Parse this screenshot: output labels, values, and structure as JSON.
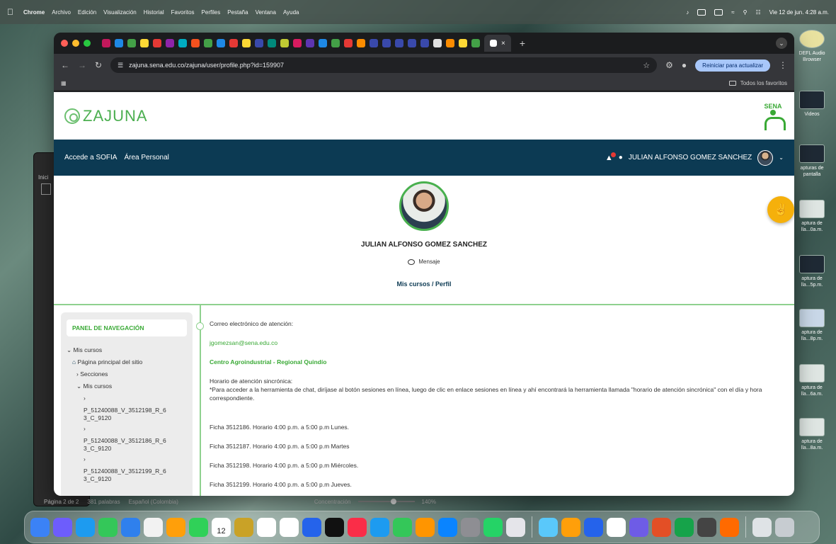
{
  "menubar": {
    "app": "Chrome",
    "items": [
      "Archivo",
      "Edición",
      "Visualización",
      "Historial",
      "Favoritos",
      "Perfiles",
      "Pestaña",
      "Ventana",
      "Ayuda"
    ],
    "datetime": "Vie 12 de jun. 4:28 a.m."
  },
  "desktop": {
    "items": [
      {
        "label": "DEFL Audio Browser"
      },
      {
        "label": "Videos"
      },
      {
        "label": "apturas de pantalla"
      },
      {
        "label": "aptura de lla...0a.m."
      },
      {
        "label": "aptura de lla...5p.m."
      },
      {
        "label": "aptura de lla...8p.m."
      },
      {
        "label": "aptura de lla...6a.m."
      },
      {
        "label": "aptura de lla...8a.m."
      }
    ]
  },
  "bg_window": {
    "label": "Inici"
  },
  "pages_status": {
    "page": "Página 2 de 2",
    "words": "381 palabras",
    "language": "Español (Colombia)",
    "focus": "Concentración",
    "zoom": "140%"
  },
  "chrome": {
    "address": "zajuna.sena.edu.co/zajuna/user/profile.php?id=159907",
    "update_button": "Reiniciar para actualizar",
    "bookmarks_folder": "Todos los favoritos",
    "colors": {
      "frame": "#202124",
      "toolbar": "#35363a",
      "update": "#a8c7fa"
    }
  },
  "site": {
    "logo_text": "ZAJUNA",
    "sena_text": "SENA",
    "nav": {
      "link1": "Accede a SOFIA",
      "link2": "Área Personal",
      "user_name": "JULIAN ALFONSO GOMEZ SANCHEZ"
    },
    "profile": {
      "name": "JULIAN ALFONSO GOMEZ SANCHEZ",
      "message": "Mensaje",
      "crumb1": "Mis cursos",
      "crumb_sep": "/",
      "crumb2": "Perfil"
    },
    "panel": {
      "title": "PANEL DE NAVEGACIÓN",
      "mis_cursos_root": "Mis cursos",
      "home": "Página principal del sitio",
      "secciones": "Secciones",
      "mis_cursos": "Mis cursos",
      "courses": [
        "P_51240088_V_3512198_R_6 3_C_9120",
        "P_51240088_V_3512186_R_6 3_C_9120",
        "P_51240088_V_3512199_R_6 3_C_9120"
      ]
    },
    "details": {
      "email_label": "Correo electrónico de atención:",
      "email": "jgomezsan@sena.edu.co",
      "center": "Centro Agroindustrial - Regional Quindío",
      "schedule_title": "Horario de atención sincrónica:",
      "schedule_note": "*Para acceder a la herramienta de chat, diríjase al botón sesiones en línea, luego de clic en enlace sesiones en línea y ahí encontrará la herramienta llamada \"horario de atención sincrónica\" con el día y hora correspondiente.",
      "fichas": [
        "Ficha 3512186. Horario 4:00 p.m. a 5:00 p.m Lunes.",
        "Ficha 3512187. Horario 4:00 p.m. a 5:00 p.m Martes",
        "Ficha 3512198. Horario 4:00 p.m. a 5:00 p.m Miércoles.",
        "Ficha 3512199. Horario 4:00 p.m. a 5:00 p.m Jueves."
      ]
    },
    "colors": {
      "navbar": "#0c3a53",
      "green": "#39a935",
      "help": "#f5b00b"
    }
  },
  "dock": {
    "calendar_day": "12"
  }
}
